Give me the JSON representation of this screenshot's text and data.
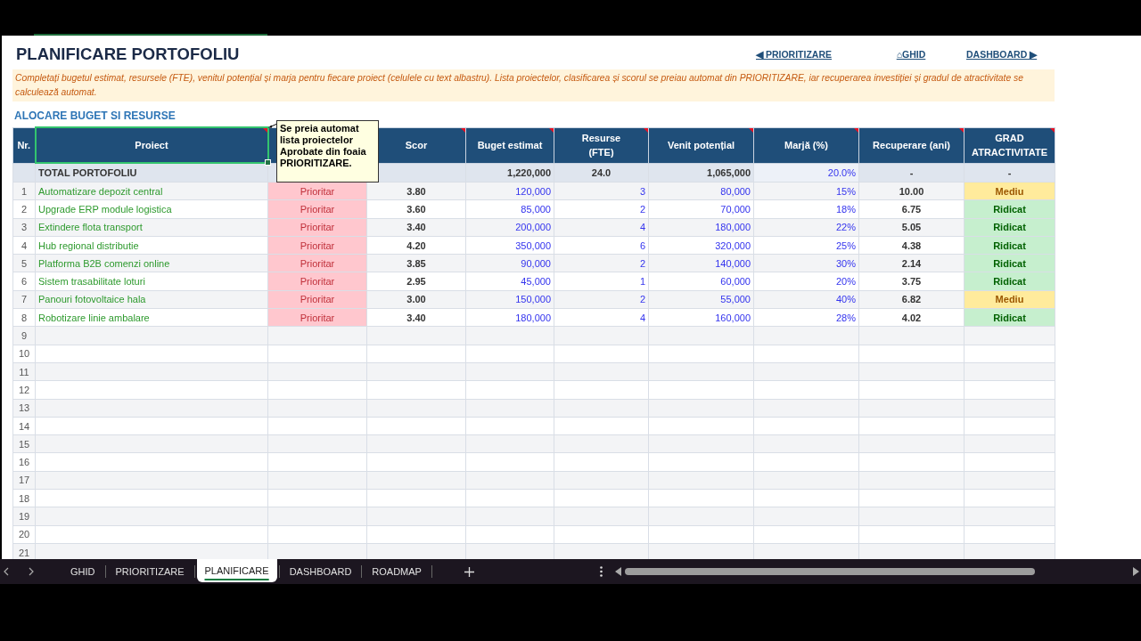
{
  "title": "PLANIFICARE PORTOFOLIU",
  "nav_links": [
    {
      "label": "◀ PRIORITIZARE"
    },
    {
      "label": "⌂GHID"
    },
    {
      "label": "DASHBOARD ▶"
    }
  ],
  "instructions": "Completați bugetul estimat, resursele (FTE), venitul potențial și marja pentru fiecare proiect (celulele cu text albastru). Lista proiectelor, clasificarea și scorul se preiau automat din PRIORITIZARE, iar recuperarea investiției și gradul de atractivitate se calculează automat.",
  "section_title": "ALOCARE BUGET SI RESURSE",
  "table": {
    "columns": [
      {
        "label": "Nr.",
        "comment": false,
        "selected": false
      },
      {
        "label": "Proiect",
        "comment": true,
        "selected": true
      },
      {
        "selected": false
      },
      {
        "label": "Scor",
        "comment": true,
        "selected": false
      },
      {
        "label": "Buget estimat",
        "comment": true,
        "selected": false
      },
      {
        "label": "Resurse\n(FTE)",
        "comment": true,
        "selected": false
      },
      {
        "label": "Venit potențial",
        "comment": true,
        "selected": false
      },
      {
        "label": "Marjă (%)",
        "comment": true,
        "selected": false
      },
      {
        "label": "Recuperare (ani)",
        "comment": true,
        "selected": false
      },
      {
        "label": "GRAD\nATRACTIVITATE",
        "comment": true,
        "selected": false
      }
    ],
    "total_row": {
      "label": "TOTAL PORTOFOLIU",
      "buget_estimat": "1,220,000",
      "resurse": "24.0",
      "venit_potential": "1,065,000",
      "marja": "20.0%",
      "recuperare": "-",
      "grad": "-"
    },
    "rows": [
      {
        "nr": "1",
        "proiect": "Automatizare depozit central",
        "column_3": "Prioritar",
        "scor": "3.80",
        "buget_estimat": "120,000",
        "resurse": "3",
        "venit_potential": "80,000",
        "marja": "15%",
        "recuperare": "10.00",
        "grad": {
          "text": "Mediu",
          "kind": "medium"
        }
      },
      {
        "nr": "2",
        "proiect": "Upgrade ERP module logistica",
        "column_3": "Prioritar",
        "scor": "3.60",
        "buget_estimat": "85,000",
        "resurse": "2",
        "venit_potential": "70,000",
        "marja": "18%",
        "recuperare": "6.75",
        "grad": {
          "text": "Ridicat",
          "kind": "high"
        }
      },
      {
        "nr": "3",
        "proiect": "Extindere flota transport",
        "column_3": "Prioritar",
        "scor": "3.40",
        "buget_estimat": "200,000",
        "resurse": "4",
        "venit_potential": "180,000",
        "marja": "22%",
        "recuperare": "5.05",
        "grad": {
          "text": "Ridicat",
          "kind": "high"
        }
      },
      {
        "nr": "4",
        "proiect": "Hub regional distributie",
        "column_3": "Prioritar",
        "scor": "4.20",
        "buget_estimat": "350,000",
        "resurse": "6",
        "venit_potential": "320,000",
        "marja": "25%",
        "recuperare": "4.38",
        "grad": {
          "text": "Ridicat",
          "kind": "high"
        }
      },
      {
        "nr": "5",
        "proiect": "Platforma B2B comenzi online",
        "column_3": "Prioritar",
        "scor": "3.85",
        "buget_estimat": "90,000",
        "resurse": "2",
        "venit_potential": "140,000",
        "marja": "30%",
        "recuperare": "2.14",
        "grad": {
          "text": "Ridicat",
          "kind": "high"
        }
      },
      {
        "nr": "6",
        "proiect": "Sistem trasabilitate loturi",
        "column_3": "Prioritar",
        "scor": "2.95",
        "buget_estimat": "45,000",
        "resurse": "1",
        "venit_potential": "60,000",
        "marja": "20%",
        "recuperare": "3.75",
        "grad": {
          "text": "Ridicat",
          "kind": "high"
        }
      },
      {
        "nr": "7",
        "proiect": "Panouri fotovoltaice hala",
        "column_3": "Prioritar",
        "scor": "3.00",
        "buget_estimat": "150,000",
        "resurse": "2",
        "venit_potential": "55,000",
        "marja": "40%",
        "recuperare": "6.82",
        "grad": {
          "text": "Mediu",
          "kind": "medium"
        }
      },
      {
        "nr": "8",
        "proiect": "Robotizare linie ambalare",
        "column_3": "Prioritar",
        "scor": "3.40",
        "buget_estimat": "180,000",
        "resurse": "4",
        "venit_potential": "160,000",
        "marja": "28%",
        "recuperare": "4.02",
        "grad": {
          "text": "Ridicat",
          "kind": "high"
        }
      },
      {
        "nr": "9"
      },
      {
        "nr": "10"
      },
      {
        "nr": "11"
      },
      {
        "nr": "12"
      },
      {
        "nr": "13"
      },
      {
        "nr": "14"
      },
      {
        "nr": "15"
      },
      {
        "nr": "16"
      },
      {
        "nr": "17"
      },
      {
        "nr": "18"
      },
      {
        "nr": "19"
      },
      {
        "nr": "20"
      },
      {
        "nr": "21"
      }
    ]
  },
  "comment_note": "Se preia automat\nlista proiectelor\nAprobate din foaia\nPRIORITIZARE.",
  "sheet_tabs": [
    {
      "label": "GHID",
      "selected": false
    },
    {
      "label": "PRIORITIZARE",
      "selected": false
    },
    {
      "label": "PLANIFICARE",
      "selected": true
    },
    {
      "label": "DASHBOARD",
      "selected": false
    },
    {
      "label": "ROADMAP",
      "selected": false
    }
  ]
}
